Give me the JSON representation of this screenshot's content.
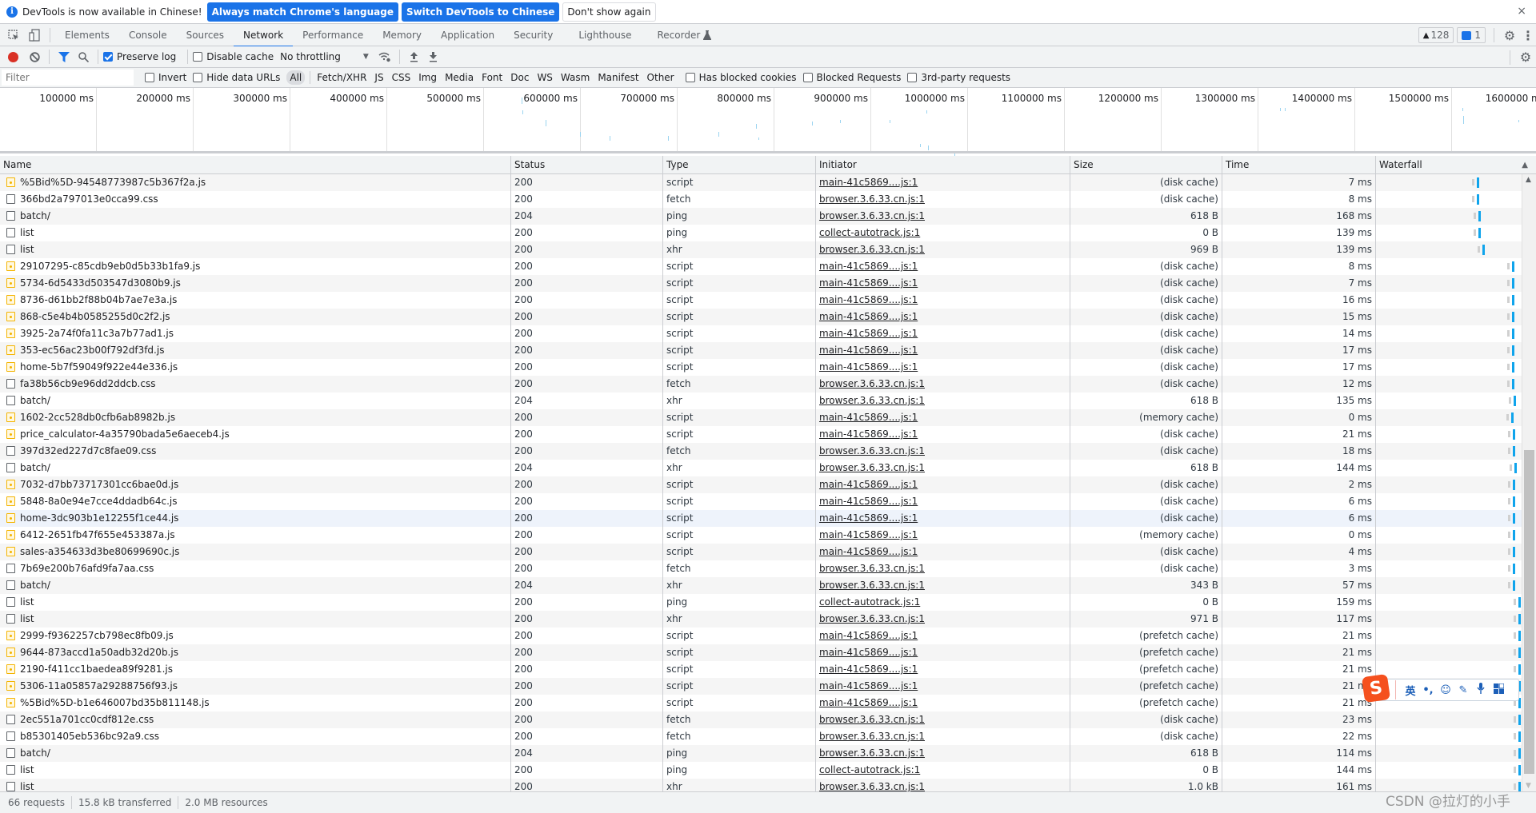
{
  "infobar": {
    "message": "DevTools is now available in Chinese!",
    "buttons": [
      "Always match Chrome's language",
      "Switch DevTools to Chinese",
      "Don't show again"
    ],
    "close": "×"
  },
  "tabs": [
    "Elements",
    "Console",
    "Sources",
    "Network",
    "Performance",
    "Memory",
    "Application",
    "Security",
    "Lighthouse",
    "Recorder"
  ],
  "active_tab": "Network",
  "badges": {
    "warnings": "128",
    "messages": "1"
  },
  "toolbar": {
    "preserve_log": "Preserve log",
    "preserve_log_checked": true,
    "disable_cache": "Disable cache",
    "disable_cache_checked": false,
    "throttling": "No throttling"
  },
  "filterbar": {
    "placeholder": "Filter",
    "invert": "Invert",
    "hide_data_urls": "Hide data URLs",
    "types": [
      "All",
      "Fetch/XHR",
      "JS",
      "CSS",
      "Img",
      "Media",
      "Font",
      "Doc",
      "WS",
      "Wasm",
      "Manifest",
      "Other"
    ],
    "active_type": "All",
    "has_blocked_cookies": "Has blocked cookies",
    "blocked_requests": "Blocked Requests",
    "third_party": "3rd-party requests"
  },
  "overview": {
    "ticks": [
      "100000 ms",
      "200000 ms",
      "300000 ms",
      "400000 ms",
      "500000 ms",
      "600000 ms",
      "700000 ms",
      "800000 ms",
      "900000 ms",
      "1000000 ms",
      "1100000 ms",
      "1200000 ms",
      "1300000 ms",
      "1400000 ms",
      "1500000 ms",
      "1600000 ms"
    ]
  },
  "columns": [
    "Name",
    "Status",
    "Type",
    "Initiator",
    "Size",
    "Time",
    "Waterfall"
  ],
  "rows": [
    {
      "name": "%5Bid%5D-94548773987c5b367f2a.js",
      "status": "200",
      "type": "script",
      "initiator": "main-41c5869....js:1",
      "size": "(disk cache)",
      "time": "7 ms"
    },
    {
      "name": "366bd2a797013e0cca99.css",
      "status": "200",
      "type": "fetch",
      "initiator": "browser.3.6.33.cn.js:1",
      "size": "(disk cache)",
      "time": "8 ms"
    },
    {
      "name": "batch/",
      "status": "204",
      "type": "ping",
      "initiator": "browser.3.6.33.cn.js:1",
      "size": "618 B",
      "time": "168 ms"
    },
    {
      "name": "list",
      "status": "200",
      "type": "ping",
      "initiator": "collect-autotrack.js:1",
      "size": "0 B",
      "time": "139 ms"
    },
    {
      "name": "list",
      "status": "200",
      "type": "xhr",
      "initiator": "browser.3.6.33.cn.js:1",
      "size": "969 B",
      "time": "139 ms"
    },
    {
      "name": "29107295-c85cdb9eb0d5b33b1fa9.js",
      "status": "200",
      "type": "script",
      "initiator": "main-41c5869....js:1",
      "size": "(disk cache)",
      "time": "8 ms"
    },
    {
      "name": "5734-6d5433d503547d3080b9.js",
      "status": "200",
      "type": "script",
      "initiator": "main-41c5869....js:1",
      "size": "(disk cache)",
      "time": "7 ms"
    },
    {
      "name": "8736-d61bb2f88b04b7ae7e3a.js",
      "status": "200",
      "type": "script",
      "initiator": "main-41c5869....js:1",
      "size": "(disk cache)",
      "time": "16 ms"
    },
    {
      "name": "868-c5e4b4b0585255d0c2f2.js",
      "status": "200",
      "type": "script",
      "initiator": "main-41c5869....js:1",
      "size": "(disk cache)",
      "time": "15 ms"
    },
    {
      "name": "3925-2a74f0fa11c3a7b77ad1.js",
      "status": "200",
      "type": "script",
      "initiator": "main-41c5869....js:1",
      "size": "(disk cache)",
      "time": "14 ms"
    },
    {
      "name": "353-ec56ac23b00f792df3fd.js",
      "status": "200",
      "type": "script",
      "initiator": "main-41c5869....js:1",
      "size": "(disk cache)",
      "time": "17 ms"
    },
    {
      "name": "home-5b7f59049f922e44e336.js",
      "status": "200",
      "type": "script",
      "initiator": "main-41c5869....js:1",
      "size": "(disk cache)",
      "time": "17 ms"
    },
    {
      "name": "fa38b56cb9e96dd2ddcb.css",
      "status": "200",
      "type": "fetch",
      "initiator": "browser.3.6.33.cn.js:1",
      "size": "(disk cache)",
      "time": "12 ms"
    },
    {
      "name": "batch/",
      "status": "204",
      "type": "xhr",
      "initiator": "browser.3.6.33.cn.js:1",
      "size": "618 B",
      "time": "135 ms"
    },
    {
      "name": "1602-2cc528db0cfb6ab8982b.js",
      "status": "200",
      "type": "script",
      "initiator": "main-41c5869....js:1",
      "size": "(memory cache)",
      "time": "0 ms"
    },
    {
      "name": "price_calculator-4a35790bada5e6aeceb4.js",
      "status": "200",
      "type": "script",
      "initiator": "main-41c5869....js:1",
      "size": "(disk cache)",
      "time": "21 ms"
    },
    {
      "name": "397d32ed227d7c8fae09.css",
      "status": "200",
      "type": "fetch",
      "initiator": "browser.3.6.33.cn.js:1",
      "size": "(disk cache)",
      "time": "18 ms"
    },
    {
      "name": "batch/",
      "status": "204",
      "type": "xhr",
      "initiator": "browser.3.6.33.cn.js:1",
      "size": "618 B",
      "time": "144 ms"
    },
    {
      "name": "7032-d7bb73717301cc6bae0d.js",
      "status": "200",
      "type": "script",
      "initiator": "main-41c5869....js:1",
      "size": "(disk cache)",
      "time": "2 ms"
    },
    {
      "name": "5848-8a0e94e7cce4ddadb64c.js",
      "status": "200",
      "type": "script",
      "initiator": "main-41c5869....js:1",
      "size": "(disk cache)",
      "time": "6 ms"
    },
    {
      "name": "home-3dc903b1e12255f1ce44.js",
      "status": "200",
      "type": "script",
      "initiator": "main-41c5869....js:1",
      "size": "(disk cache)",
      "time": "6 ms"
    },
    {
      "name": "6412-2651fb47f655e453387a.js",
      "status": "200",
      "type": "script",
      "initiator": "main-41c5869....js:1",
      "size": "(memory cache)",
      "time": "0 ms"
    },
    {
      "name": "sales-a354633d3be80699690c.js",
      "status": "200",
      "type": "script",
      "initiator": "main-41c5869....js:1",
      "size": "(disk cache)",
      "time": "4 ms"
    },
    {
      "name": "7b69e200b76afd9fa7aa.css",
      "status": "200",
      "type": "fetch",
      "initiator": "browser.3.6.33.cn.js:1",
      "size": "(disk cache)",
      "time": "3 ms"
    },
    {
      "name": "batch/",
      "status": "204",
      "type": "xhr",
      "initiator": "browser.3.6.33.cn.js:1",
      "size": "343 B",
      "time": "57 ms"
    },
    {
      "name": "list",
      "status": "200",
      "type": "ping",
      "initiator": "collect-autotrack.js:1",
      "size": "0 B",
      "time": "159 ms"
    },
    {
      "name": "list",
      "status": "200",
      "type": "xhr",
      "initiator": "browser.3.6.33.cn.js:1",
      "size": "971 B",
      "time": "117 ms"
    },
    {
      "name": "2999-f9362257cb798ec8fb09.js",
      "status": "200",
      "type": "script",
      "initiator": "main-41c5869....js:1",
      "size": "(prefetch cache)",
      "time": "21 ms"
    },
    {
      "name": "9644-873accd1a50adb32d20b.js",
      "status": "200",
      "type": "script",
      "initiator": "main-41c5869....js:1",
      "size": "(prefetch cache)",
      "time": "21 ms"
    },
    {
      "name": "2190-f411cc1baedea89f9281.js",
      "status": "200",
      "type": "script",
      "initiator": "main-41c5869....js:1",
      "size": "(prefetch cache)",
      "time": "21 ms"
    },
    {
      "name": "5306-11a05857a29288756f93.js",
      "status": "200",
      "type": "script",
      "initiator": "main-41c5869....js:1",
      "size": "(prefetch cache)",
      "time": "21 ms"
    },
    {
      "name": "%5Bid%5D-b1e646007bd35b811148.js",
      "status": "200",
      "type": "script",
      "initiator": "main-41c5869....js:1",
      "size": "(prefetch cache)",
      "time": "21 ms"
    },
    {
      "name": "2ec551a701cc0cdf812e.css",
      "status": "200",
      "type": "fetch",
      "initiator": "browser.3.6.33.cn.js:1",
      "size": "(disk cache)",
      "time": "23 ms"
    },
    {
      "name": "b85301405eb536bc92a9.css",
      "status": "200",
      "type": "fetch",
      "initiator": "browser.3.6.33.cn.js:1",
      "size": "(disk cache)",
      "time": "22 ms"
    },
    {
      "name": "batch/",
      "status": "204",
      "type": "ping",
      "initiator": "browser.3.6.33.cn.js:1",
      "size": "618 B",
      "time": "114 ms"
    },
    {
      "name": "list",
      "status": "200",
      "type": "ping",
      "initiator": "collect-autotrack.js:1",
      "size": "0 B",
      "time": "144 ms"
    },
    {
      "name": "list",
      "status": "200",
      "type": "xhr",
      "initiator": "browser.3.6.33.cn.js:1",
      "size": "1.0 kB",
      "time": "161 ms"
    }
  ],
  "highlighted_row": 20,
  "statusbar": {
    "requests": "66 requests",
    "transferred": "15.8 kB transferred",
    "resources": "2.0 MB resources"
  },
  "ime": {
    "logo": "S",
    "mode": "英",
    "punct": "•,",
    "emoji": "☺",
    "pen": "✎",
    "mic": "🎙",
    "grid": "▦"
  },
  "watermark": "CSDN @拉灯的小手",
  "colors": {
    "accent": "#1a73e8",
    "record": "#d93025",
    "waterfall": "#0fa4ec",
    "script_icon": "#f4b400"
  }
}
